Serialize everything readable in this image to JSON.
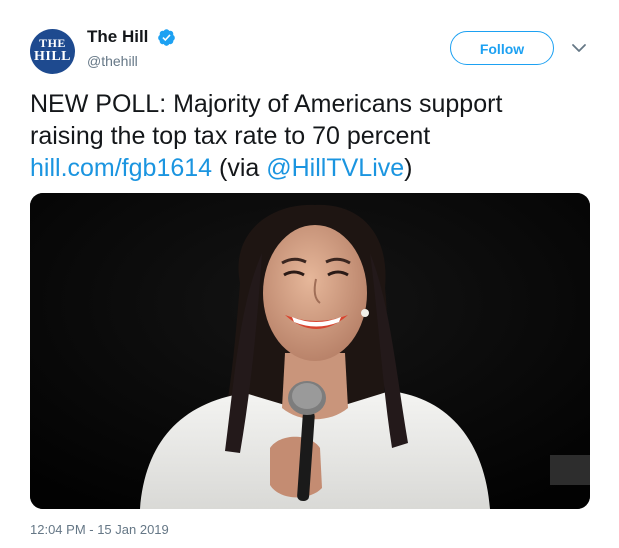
{
  "account": {
    "name": "The Hill",
    "handle": "@thehill",
    "avatar_text_line1": "THE",
    "avatar_text_line2": "HILL",
    "verified_icon": "verified-badge-icon"
  },
  "follow_label": "Follow",
  "tweet": {
    "text_line1": "NEW POLL: Majority of Americans support",
    "text_line2": "raising the top tax rate to 70 percent",
    "link": "hill.com/fgb1614",
    "via_prefix": " (via ",
    "mention": "@HillTVLive",
    "via_suffix": ")"
  },
  "timestamp": "12:04 PM - 15 Jan 2019",
  "colors": {
    "accent": "#1da1f2",
    "link": "#1b95e0",
    "text": "#14171a",
    "muted": "#657786",
    "avatar_bg": "#1e4a8f"
  }
}
